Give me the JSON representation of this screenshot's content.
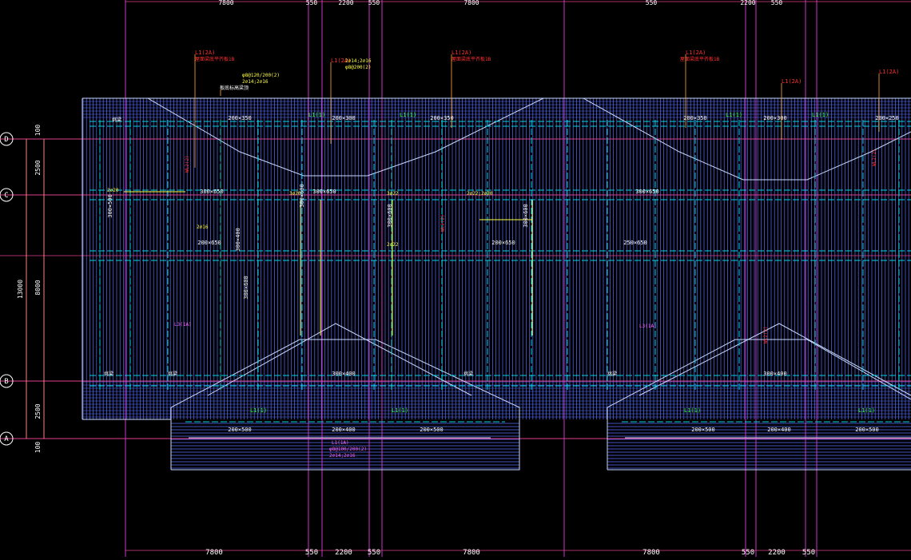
{
  "colors": {
    "background": "#000000",
    "grid_axis": "#e0408a",
    "column_line": "#cc33cc",
    "hatch": "#5a6cff",
    "beam_cyan": "#00d5e6",
    "beam_outline": "#c8d8ff",
    "text_white": "#ffffff",
    "text_yellow": "#ffff40",
    "text_red": "#ff3030",
    "text_green": "#30ff30",
    "text_magenta": "#ff60ff",
    "text_orange": "#ffaa30",
    "dimension": "#ff8080"
  },
  "dimensions": {
    "top": [
      "7800",
      "550",
      "2200",
      "550",
      "7800",
      "550",
      "2200",
      "550"
    ],
    "bottom": [
      "7800",
      "550",
      "2200",
      "550",
      "7800",
      "7800",
      "550",
      "2200",
      "550"
    ],
    "left_outer": "13000",
    "left_inner": [
      "100",
      "2500",
      "8000",
      "2500",
      "100"
    ]
  },
  "axes": {
    "rows": [
      "D",
      "C",
      "B",
      "A"
    ]
  },
  "labels": {
    "beam_sizes": [
      "200×350",
      "200×300",
      "200×350",
      "200×350",
      "200×300",
      "200×250",
      "300×650",
      "300×650",
      "300×600",
      "300×600",
      "300×650",
      "300×500",
      "300×600",
      "300×600",
      "300×400",
      "200×650",
      "200×650",
      "250×650",
      "200×500",
      "200×400",
      "200×500",
      "200×500",
      "200×400",
      "200×500",
      "300×400",
      "300×400"
    ],
    "red_tags": [
      "L1(2A)",
      "L1(2A)",
      "L1(2A)",
      "L1(2A)",
      "L1(2A)",
      "L1(2A)"
    ],
    "red_notes": [
      "屋面梁底平齐板1B",
      "屋面梁底平齐板1B",
      "屋面梁底平齐板1B"
    ],
    "yellow_notes": [
      "φ8@120/200(2)",
      "2⌀14;2⌀16",
      "φ8@200(2)",
      "2⌀14;2⌀16",
      "2⌀16",
      "3⌀20",
      "3⌀22",
      "2⌀22",
      "2⌀20",
      "2⌀22;2⌀20"
    ],
    "green_tags": [
      "L1(1)",
      "L1(1)",
      "L1(1)",
      "L1(1)",
      "L1(1)",
      "L1(1)",
      "L1(1)",
      "L1(1)"
    ],
    "white_notes": [
      "板底标高梁顶",
      "挑梁",
      "挑梁",
      "挑梁",
      "挑梁",
      "挑梁"
    ],
    "magenta_notes": [
      "L1(1A)",
      "φ8@100/200(2)",
      "2⌀14;2⌀16",
      "L3(1A)",
      "L3(1A)"
    ],
    "ring_notes": [
      "WL2(2)",
      "WL2(2)",
      "WL2(2)",
      "WL2(2)"
    ]
  }
}
